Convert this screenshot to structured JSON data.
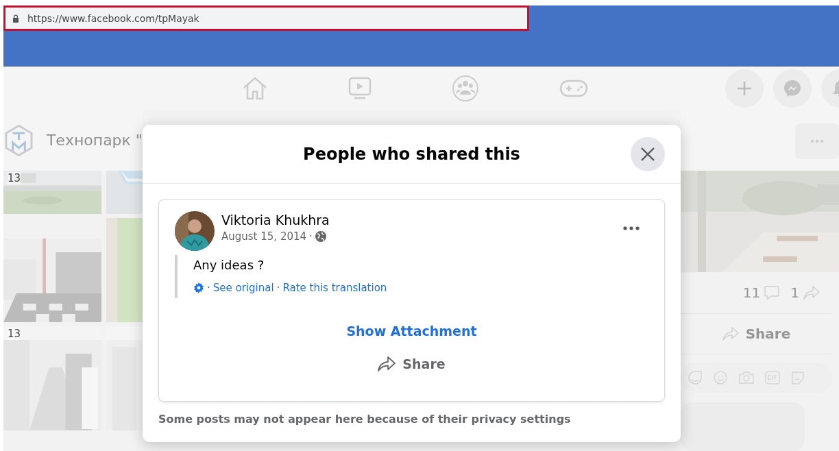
{
  "address_bar": {
    "url": "https://www.facebook.com/tpMayak"
  },
  "background_page": {
    "page_name": "Технопарк \"",
    "photo_dates": [
      "13",
      "13"
    ],
    "comment_count": "11",
    "share_count": "1",
    "share_label": "Share"
  },
  "dialog": {
    "title": "People who shared this",
    "separator": "·",
    "post": {
      "author": "Viktoria Khukhra",
      "date": "August 15, 2014",
      "text": "Any ideas ?",
      "translation_links": [
        "See original",
        "Rate this translation"
      ],
      "attachment_link": "Show Attachment",
      "share_label": "Share"
    },
    "footer_note": "Some posts may not appear here because of their privacy settings"
  }
}
